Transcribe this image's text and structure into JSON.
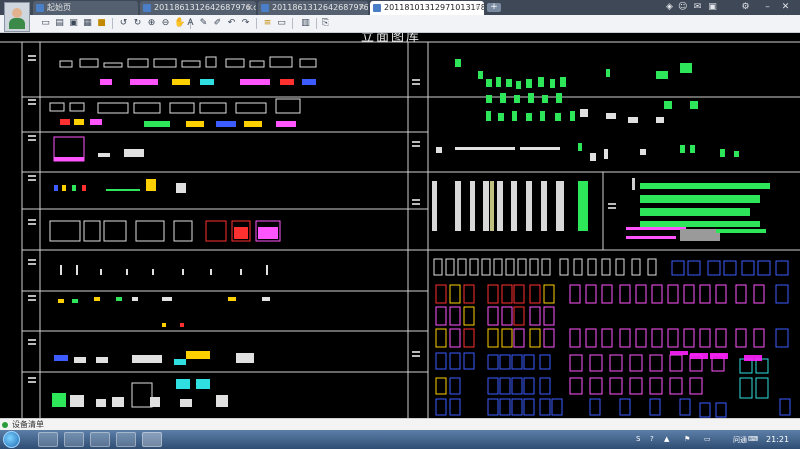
{
  "tabs": [
    {
      "label": "起始页",
      "state": "inactive",
      "closable": false
    },
    {
      "label": "20118613126426879​76.dwg",
      "state": "inactive",
      "closable": true
    },
    {
      "label": "2011861312642687976.dwg",
      "state": "inactive",
      "closable": true
    },
    {
      "label": "2011810131297101317​8.d...",
      "state": "active",
      "closable": true
    }
  ],
  "window_controls": [
    "gift-icon",
    "user-icon",
    "chat-icon",
    "mail-icon",
    "settings-icon",
    "minimize-icon",
    "close-icon"
  ],
  "toolbar_buttons": [
    "new",
    "open",
    "save",
    "saveas",
    "print",
    "lock",
    "rotate-left",
    "rotate-right",
    "zoom-in",
    "zoom-out",
    "pan",
    "zoom-window",
    "text",
    "pencil",
    "brush",
    "undo",
    "redo",
    "undo2",
    "layer",
    "layer2",
    "measure",
    "export"
  ],
  "drawing": {
    "title": "立面图库",
    "left_rows": [
      "立面",
      "立面",
      "立面",
      "立面",
      "立面",
      "立面",
      "立面",
      "立面",
      "立面"
    ],
    "right_rows": [
      "立面",
      "立面",
      "立面",
      "立面",
      "立面"
    ]
  },
  "status": {
    "label": "设备清单"
  },
  "tray": {
    "ime": "问通",
    "time": "21:21"
  },
  "colors": {
    "titlebar": "#3f4856",
    "toolbar": "#f1f3f6",
    "canvas": "#000000",
    "taskbar": "#2f4d73"
  }
}
